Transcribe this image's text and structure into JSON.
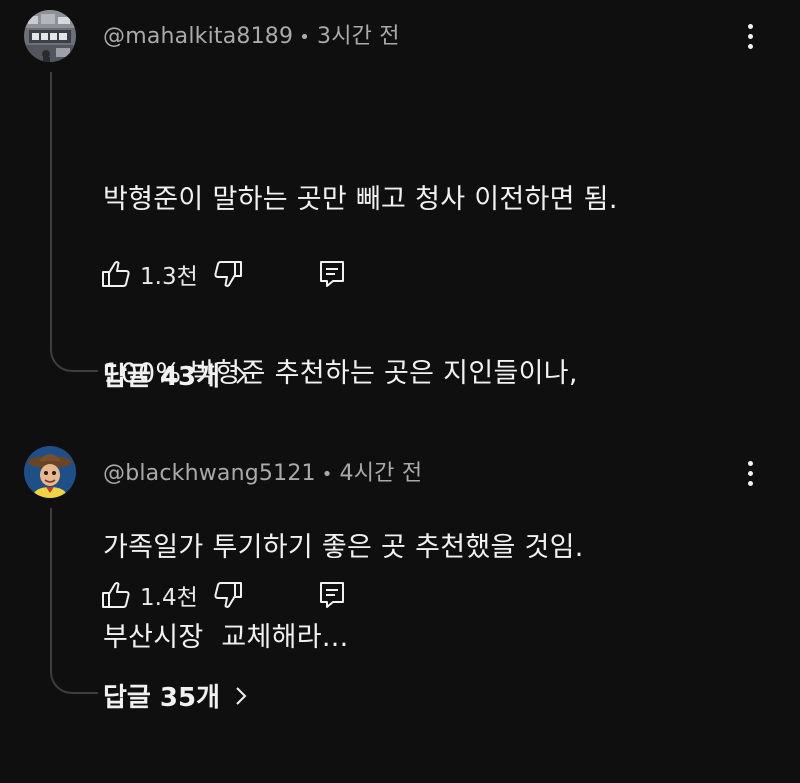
{
  "comments": [
    {
      "author": "@mahalkita8189",
      "time": "3시간 전",
      "lines": [
        "박형준이 말하는 곳만 빼고 청사 이전하면 됨.",
        "100% 박형준 추천하는 곳은 지인들이나,",
        "가족일가 투기하기 좋은 곳 추천했을 것임."
      ],
      "likes": "1.3천",
      "replies": "답글 43개",
      "avatar_icon": "avatar-collage-icon"
    },
    {
      "author": "@blackhwang5121",
      "time": "4시간 전",
      "lines": [
        "부산시장  교체해라..."
      ],
      "likes": "1.4천",
      "replies": "답글 35개",
      "avatar_icon": "avatar-cowboy-icon"
    }
  ],
  "separator": "•",
  "colors": {
    "background": "#0f0f0f",
    "text": "#f1f1f1",
    "meta": "#aaaaaa",
    "thread_line": "#3d3d3d"
  }
}
